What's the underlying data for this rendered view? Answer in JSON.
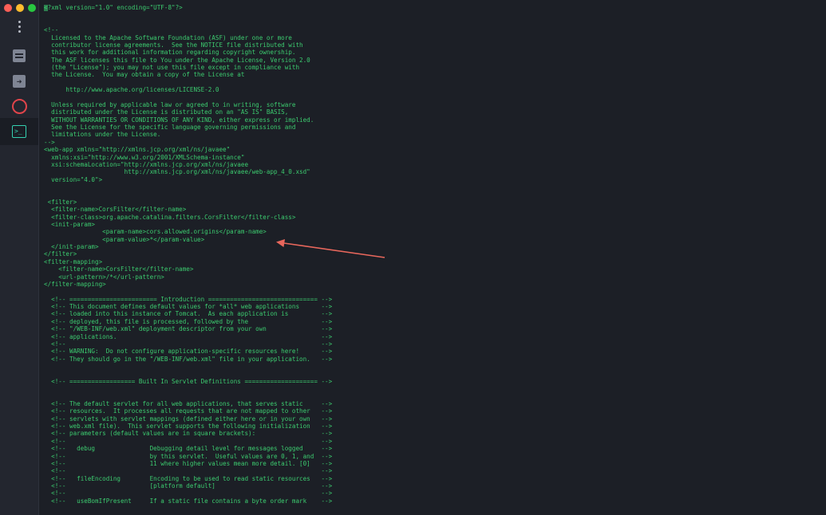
{
  "window": {
    "controls": [
      "close",
      "minimize",
      "maximize"
    ]
  },
  "sidebar": {
    "items": [
      {
        "name": "menu",
        "icon": "vertical-dots-icon"
      },
      {
        "name": "server",
        "icon": "server-icon"
      },
      {
        "name": "forward",
        "icon": "forward-arrow-icon"
      },
      {
        "name": "record",
        "icon": "record-circle-icon",
        "color": "#e0444a"
      },
      {
        "name": "terminal",
        "icon": "terminal-icon",
        "active": true,
        "color": "#35d0b0"
      }
    ]
  },
  "editor": {
    "text_color": "#3ccb6f",
    "lines": [
      "<?xml version=\"1.0\" encoding=\"UTF-8\"?>",
      "",
      "",
      "<!--",
      "  Licensed to the Apache Software Foundation (ASF) under one or more",
      "  contributor license agreements.  See the NOTICE file distributed with",
      "  this work for additional information regarding copyright ownership.",
      "  The ASF licenses this file to You under the Apache License, Version 2.0",
      "  (the \"License\"); you may not use this file except in compliance with",
      "  the License.  You may obtain a copy of the License at",
      "",
      "      http://www.apache.org/licenses/LICENSE-2.0",
      "",
      "  Unless required by applicable law or agreed to in writing, software",
      "  distributed under the License is distributed on an \"AS IS\" BASIS,",
      "  WITHOUT WARRANTIES OR CONDITIONS OF ANY KIND, either express or implied.",
      "  See the License for the specific language governing permissions and",
      "  limitations under the License.",
      "-->",
      "<web-app xmlns=\"http://xmlns.jcp.org/xml/ns/javaee\"",
      "  xmlns:xsi=\"http://www.w3.org/2001/XMLSchema-instance\"",
      "  xsi:schemaLocation=\"http://xmlns.jcp.org/xml/ns/javaee",
      "                      http://xmlns.jcp.org/xml/ns/javaee/web-app_4_0.xsd\"",
      "  version=\"4.0\">",
      "",
      "",
      " <filter>",
      "  <filter-name>CorsFilter</filter-name>",
      "  <filter-class>org.apache.catalina.filters.CorsFilter</filter-class>",
      "  <init-param>",
      "                <param-name>cors.allowed.origins</param-name>",
      "                <param-value>*</param-value>",
      "  </init-param>",
      "</filter>",
      "<filter-mapping>",
      "    <filter-name>CorsFilter</filter-name>",
      "    <url-pattern>/*</url-pattern>",
      "</filter-mapping>",
      "",
      "  <!-- ======================== Introduction ============================== -->",
      "  <!-- This document defines default values for *all* web applications      -->",
      "  <!-- loaded into this instance of Tomcat.  As each application is         -->",
      "  <!-- deployed, this file is processed, followed by the                    -->",
      "  <!-- \"/WEB-INF/web.xml\" deployment descriptor from your own               -->",
      "  <!-- applications.                                                        -->",
      "  <!--                                                                      -->",
      "  <!-- WARNING:  Do not configure application-specific resources here!      -->",
      "  <!-- They should go in the \"/WEB-INF/web.xml\" file in your application.   -->",
      "",
      "",
      "  <!-- ================== Built In Servlet Definitions ==================== -->",
      "",
      "",
      "  <!-- The default servlet for all web applications, that serves static     -->",
      "  <!-- resources.  It processes all requests that are not mapped to other   -->",
      "  <!-- servlets with servlet mappings (defined either here or in your own   -->",
      "  <!-- web.xml file).  This servlet supports the following initialization   -->",
      "  <!-- parameters (default values are in square brackets):                  -->",
      "  <!--                                                                      -->",
      "  <!--   debug               Debugging detail level for messages logged     -->",
      "  <!--                       by this servlet.  Useful values are 0, 1, and  -->",
      "  <!--                       11 where higher values mean more detail. [0]   -->",
      "  <!--                                                                      -->",
      "  <!--   fileEncoding        Encoding to be used to read static resources   -->",
      "  <!--                       [platform default]                             -->",
      "  <!--                                                                      -->",
      "  <!--   useBomIfPresent     If a static file contains a byte order mark    -->"
    ]
  },
  "annotation": {
    "type": "arrow",
    "color": "#e8675c"
  }
}
